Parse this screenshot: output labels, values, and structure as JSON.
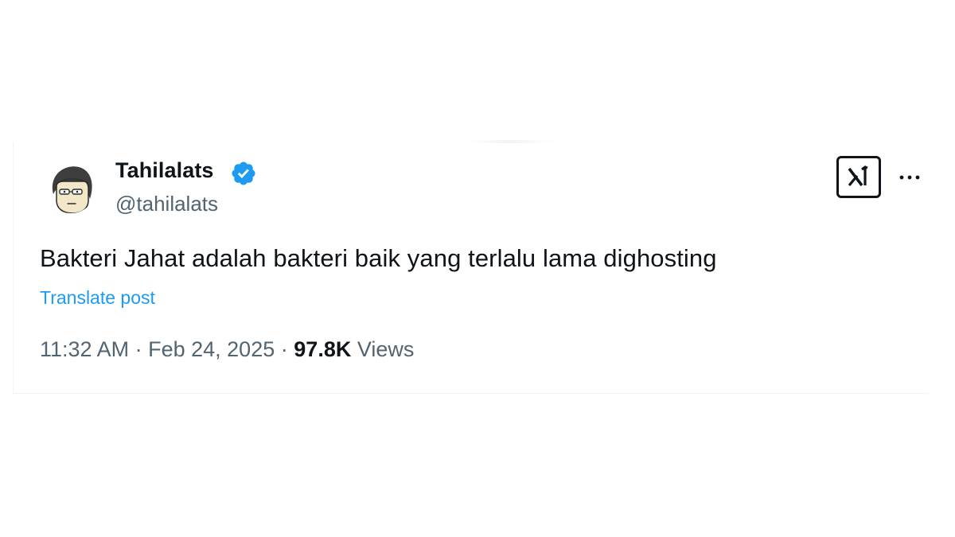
{
  "tweet": {
    "author": {
      "display_name": "Tahilalats",
      "handle": "@tahilalats",
      "verified": true
    },
    "text": "Bakteri Jahat adalah bakteri baik yang terlalu lama dighosting",
    "translate_label": "Translate post",
    "time": "11:32 AM",
    "separator": "·",
    "date": "Feb 24, 2025",
    "views_count": "97.8K",
    "views_label": "Views"
  },
  "icons": {
    "verified": "verified-badge-icon",
    "x_logo": "x-logo-icon",
    "more": "more-horizontal-icon"
  },
  "colors": {
    "accent": "#1d9bf0",
    "secondary_text": "#536471",
    "primary_text": "#0f1419"
  }
}
